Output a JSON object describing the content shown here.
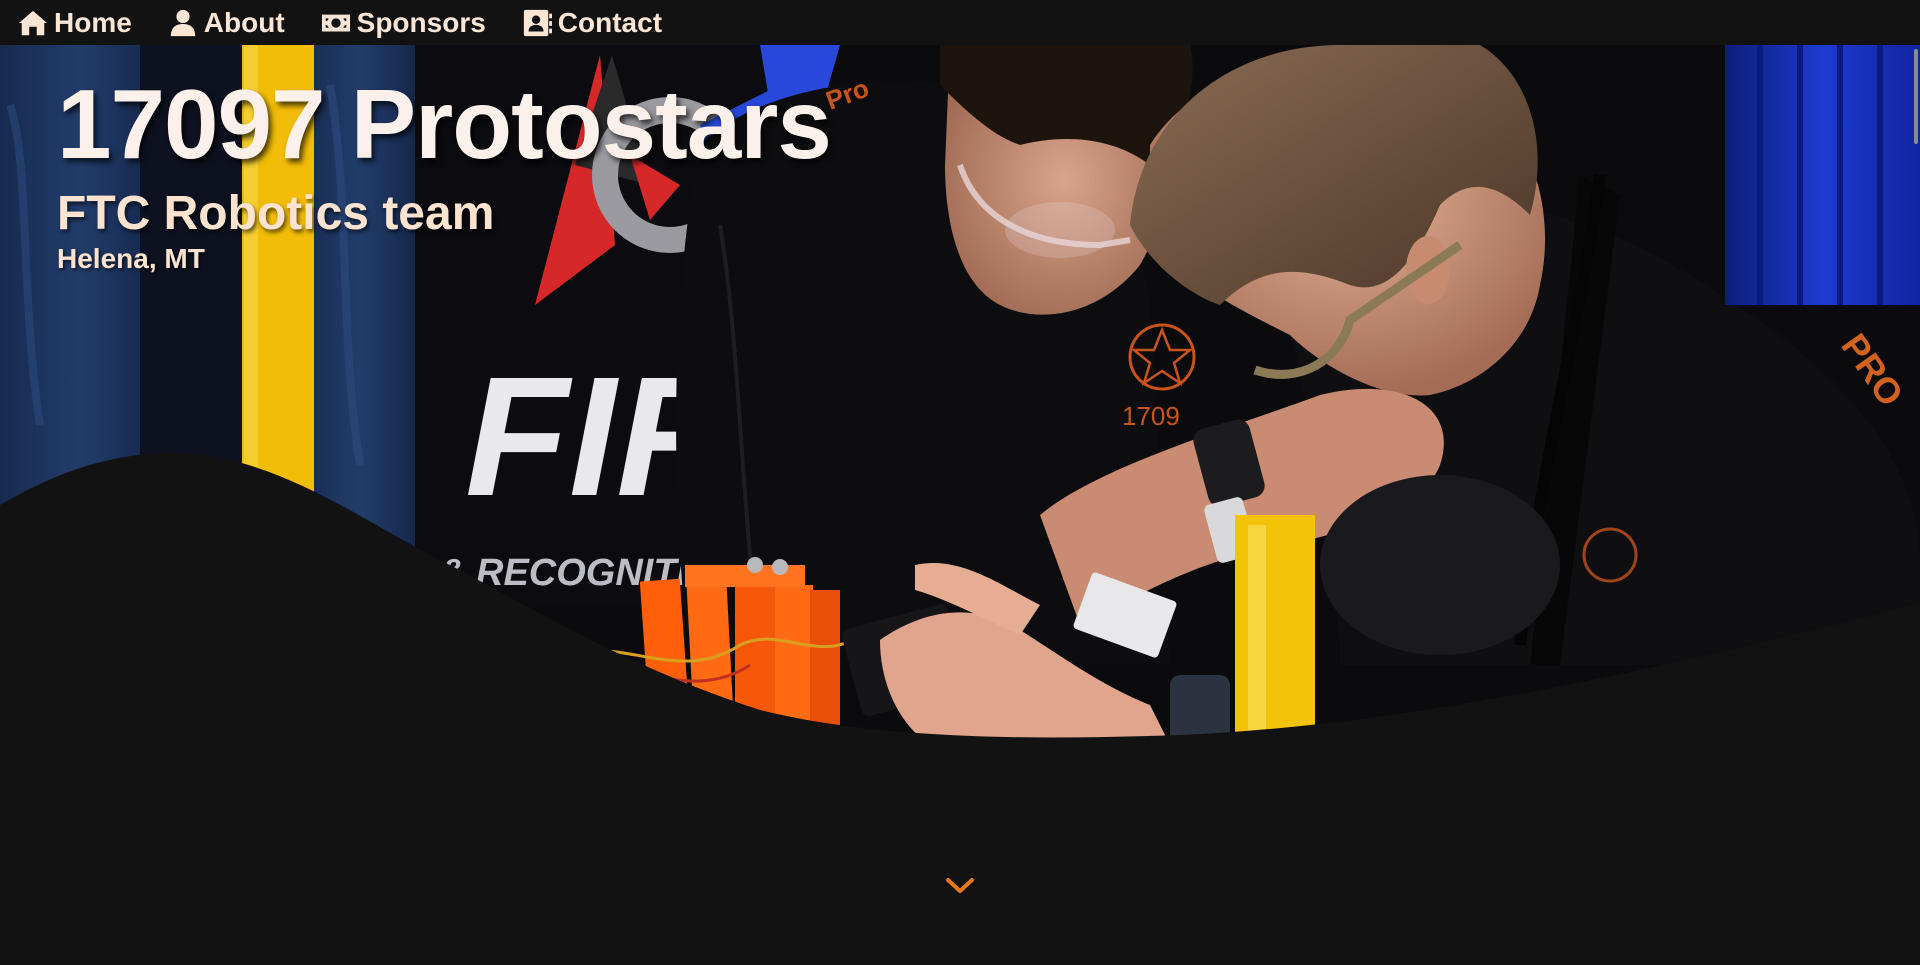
{
  "nav": {
    "items": [
      {
        "label": "Home",
        "icon": "home-icon"
      },
      {
        "label": "About",
        "icon": "user-icon"
      },
      {
        "label": "Sponsors",
        "icon": "money-icon"
      },
      {
        "label": "Contact",
        "icon": "contact-card-icon"
      }
    ]
  },
  "hero": {
    "title": "17097 Protostars",
    "subtitle": "FTC Robotics team",
    "location": "Helena, MT",
    "banner_text_1": "FIR",
    "banner_text_2": "N & RECOGNITI"
  },
  "scroll_icon": "chevron-down-icon",
  "colors": {
    "background": "#121212",
    "text_cream": "#fbe3d0",
    "accent_orange": "#e8781a",
    "robot_orange": "#ff6a10",
    "bollard_yellow": "#f5c30a",
    "curtain_blue": "#1736b8"
  }
}
